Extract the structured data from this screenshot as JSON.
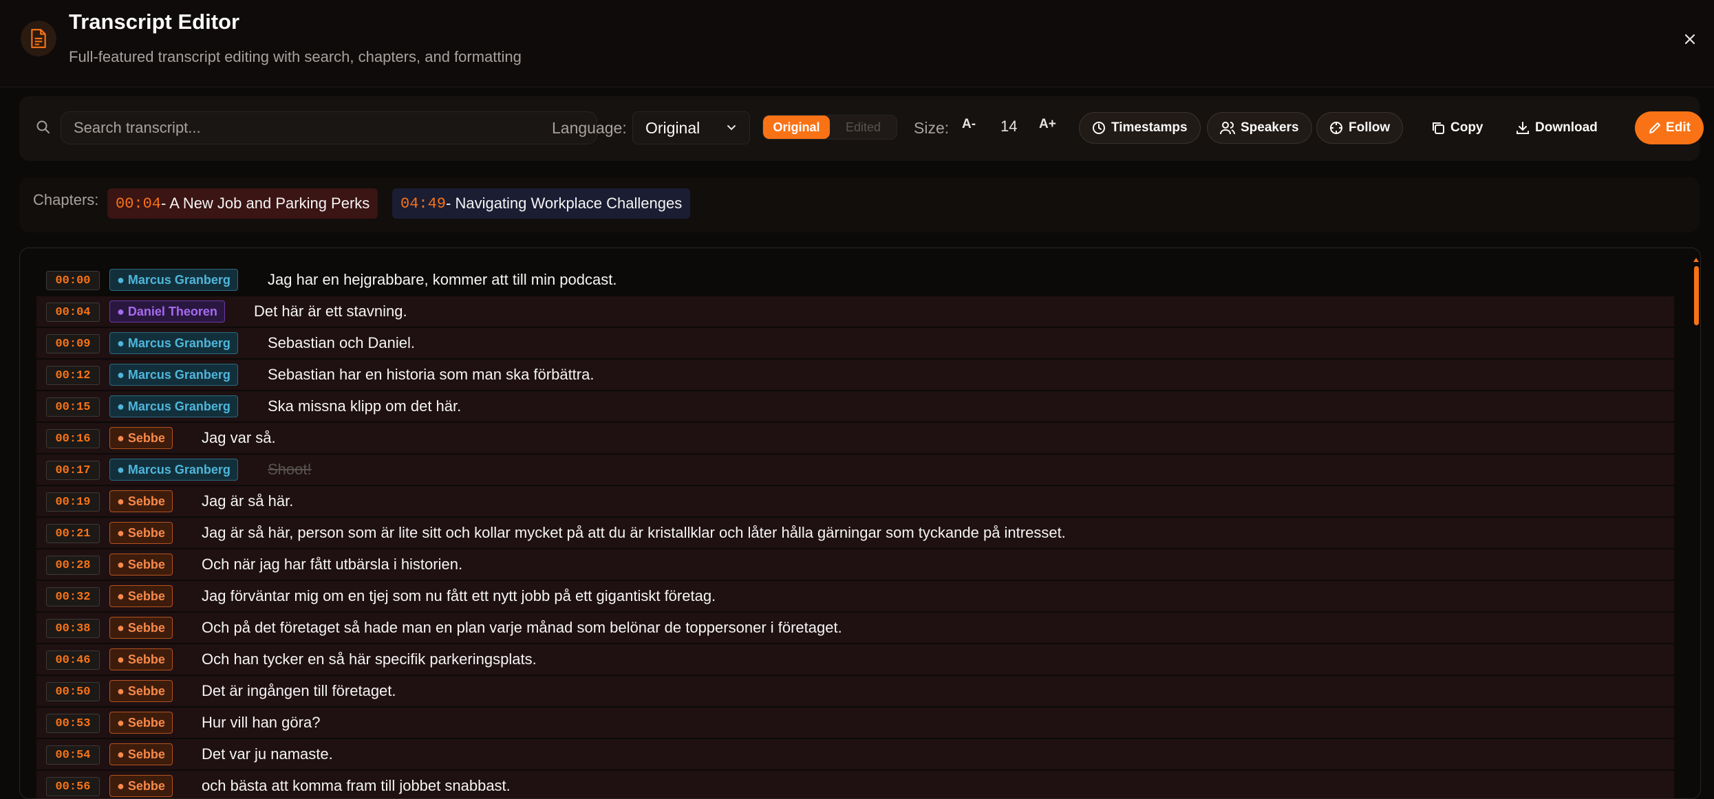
{
  "header": {
    "title": "Transcript Editor",
    "subtitle": "Full-featured transcript editing with search, chapters, and formatting"
  },
  "toolbar": {
    "search_placeholder": "Search transcript...",
    "language_label": "Language:",
    "language_value": "Original",
    "toggle_original": "Original",
    "toggle_edited": "Edited",
    "size_label": "Size:",
    "size_decrease": "A-",
    "size_value": "14",
    "size_increase": "A+",
    "timestamps_label": "Timestamps",
    "speakers_label": "Speakers",
    "follow_label": "Follow",
    "copy_label": "Copy",
    "download_label": "Download",
    "edit_label": "Edit"
  },
  "chapters": {
    "label": "Chapters:",
    "items": [
      {
        "time": "00:04",
        "title": " - A New Job and Parking Perks"
      },
      {
        "time": "04:49",
        "title": " - Navigating Workplace Challenges"
      }
    ]
  },
  "transcript": [
    {
      "time": "00:00",
      "speaker": "● Marcus Granberg",
      "text": "Jag har en hejgrabbare, kommer att till min podcast."
    },
    {
      "time": "00:04",
      "speaker": "● Daniel Theoren",
      "text": "Det här är ett stavning."
    },
    {
      "time": "00:09",
      "speaker": "● Marcus Granberg",
      "text": "Sebastian och Daniel."
    },
    {
      "time": "00:12",
      "speaker": "● Marcus Granberg",
      "text": "Sebastian har en historia som man ska förbättra."
    },
    {
      "time": "00:15",
      "speaker": "● Marcus Granberg",
      "text": "Ska missna klipp om det här."
    },
    {
      "time": "00:16",
      "speaker": "● Sebbe",
      "text": "Jag var så."
    },
    {
      "time": "00:17",
      "speaker": "● Marcus Granberg",
      "text": "Shoot!"
    },
    {
      "time": "00:19",
      "speaker": "● Sebbe",
      "text": "Jag är så här."
    },
    {
      "time": "00:21",
      "speaker": "● Sebbe",
      "text": "Jag är så här, person som är lite sitt och kollar mycket på att du är kristallklar och låter hålla gärningar som tyckande på intresset."
    },
    {
      "time": "00:28",
      "speaker": "● Sebbe",
      "text": "Och när jag har fått utbärsla i historien."
    },
    {
      "time": "00:32",
      "speaker": "● Sebbe",
      "text": "Jag förväntar mig om en tjej som nu fått ett nytt jobb på ett gigantiskt företag."
    },
    {
      "time": "00:38",
      "speaker": "● Sebbe",
      "text": "Och på det företaget så hade man en plan varje månad som belönar de toppersoner i företaget."
    },
    {
      "time": "00:46",
      "speaker": "● Sebbe",
      "text": "Och han tycker en så här specifik parkeringsplats."
    },
    {
      "time": "00:50",
      "speaker": "● Sebbe",
      "text": "Det är ingången till företaget."
    },
    {
      "time": "00:53",
      "speaker": "● Sebbe",
      "text": "Hur vill han göra?"
    },
    {
      "time": "00:54",
      "speaker": "● Sebbe",
      "text": "Det var ju namaste."
    },
    {
      "time": "00:56",
      "speaker": "● Sebbe",
      "text": "och bästa att komma fram till jobbet snabbast."
    }
  ],
  "colors": {
    "accent": "#f97316",
    "background": "#0c0a09",
    "row_highlight": "#1f1012"
  }
}
